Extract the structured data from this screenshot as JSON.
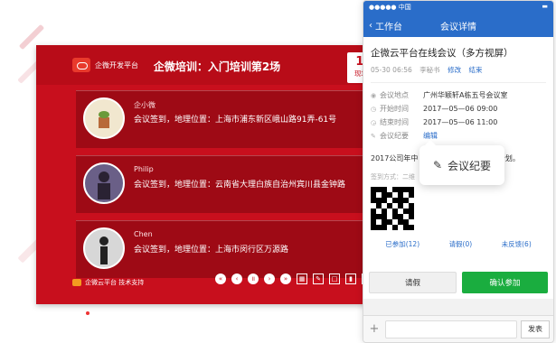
{
  "screen": {
    "brand": "企微开发平台",
    "title": "企微培训：入门培训第2场",
    "counter": {
      "value": "168",
      "label": "现场评论"
    },
    "cards": [
      {
        "name": "企小微",
        "text": "会议签到，地理位置：上海市浦东新区峨山路91弄-61号"
      },
      {
        "name": "Philip",
        "text": "会议签到，地理位置：云南省大理白族自治州宾川县金钟路"
      },
      {
        "name": "Chen",
        "text": "会议签到，地理位置：上海市闵行区万源路"
      }
    ],
    "footer_brand": "企微云平台 技术支持"
  },
  "phone": {
    "status": {
      "carrier": "●●●●● 中国",
      "battery": "▬"
    },
    "nav": {
      "back": "工作台",
      "title": "会议详情"
    },
    "meeting": {
      "title": "企微云平台在线会议（多方视屏）",
      "date": "05-30 06:56",
      "author": "李秘书",
      "edit": "修改",
      "end": "结束"
    },
    "details": [
      {
        "label": "会议地点",
        "value": "广州华颖轩A栋五号会议室"
      },
      {
        "label": "开始时间",
        "value": "2017—05—06 09:00"
      },
      {
        "label": "结束时间",
        "value": "2017—05—06 11:00"
      },
      {
        "label": "会议纪要",
        "value": "编辑"
      }
    ],
    "note": "2017公司年中",
    "note_tail": "计划。",
    "signin": "签到方式：二维",
    "stats": {
      "joined": "已参加(12)",
      "pending": "请假(0)",
      "unfeedback": "未反馈(6)"
    },
    "buttons": {
      "leave": "请假",
      "join": "确认参加"
    },
    "send": "发表"
  },
  "popover": {
    "label": "会议纪要"
  }
}
